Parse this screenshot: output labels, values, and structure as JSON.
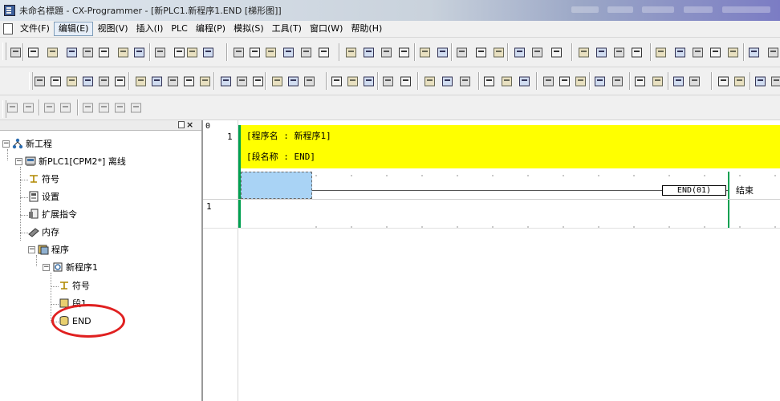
{
  "window": {
    "title": "未命名標題 - CX-Programmer - [新PLC1.新程序1.END [梯形图]]"
  },
  "menu": {
    "items": [
      {
        "label": "文件(F)",
        "active": false
      },
      {
        "label": "编辑(E)",
        "active": true
      },
      {
        "label": "视图(V)",
        "active": false
      },
      {
        "label": "插入(I)",
        "active": false
      },
      {
        "label": "PLC",
        "active": false
      },
      {
        "label": "编程(P)",
        "active": false
      },
      {
        "label": "模拟(S)",
        "active": false
      },
      {
        "label": "工具(T)",
        "active": false
      },
      {
        "label": "窗口(W)",
        "active": false
      },
      {
        "label": "帮助(H)",
        "active": false
      }
    ]
  },
  "tree": {
    "project": "新工程",
    "plc": "新PLC1[CPM2*] 离线",
    "symbols": "符号",
    "settings": "设置",
    "expansion": "扩展指令",
    "memory": "内存",
    "programs": "程序",
    "program1": "新程序1",
    "prog_symbols": "符号",
    "section1": "段1",
    "end": "END"
  },
  "ladder": {
    "col_marker": "0",
    "rung1_num": "1",
    "rung2_num": "1",
    "program_name": "[程序名 : 新程序1]",
    "section_name": "[段名称 : END]",
    "end_instr": "END(01)",
    "end_comment": "结束"
  },
  "colors": {
    "header_yellow": "#ffff00",
    "bus_green": "#00a050",
    "cursor_blue": "#a9d3f5",
    "annotation_red": "#e02020"
  }
}
